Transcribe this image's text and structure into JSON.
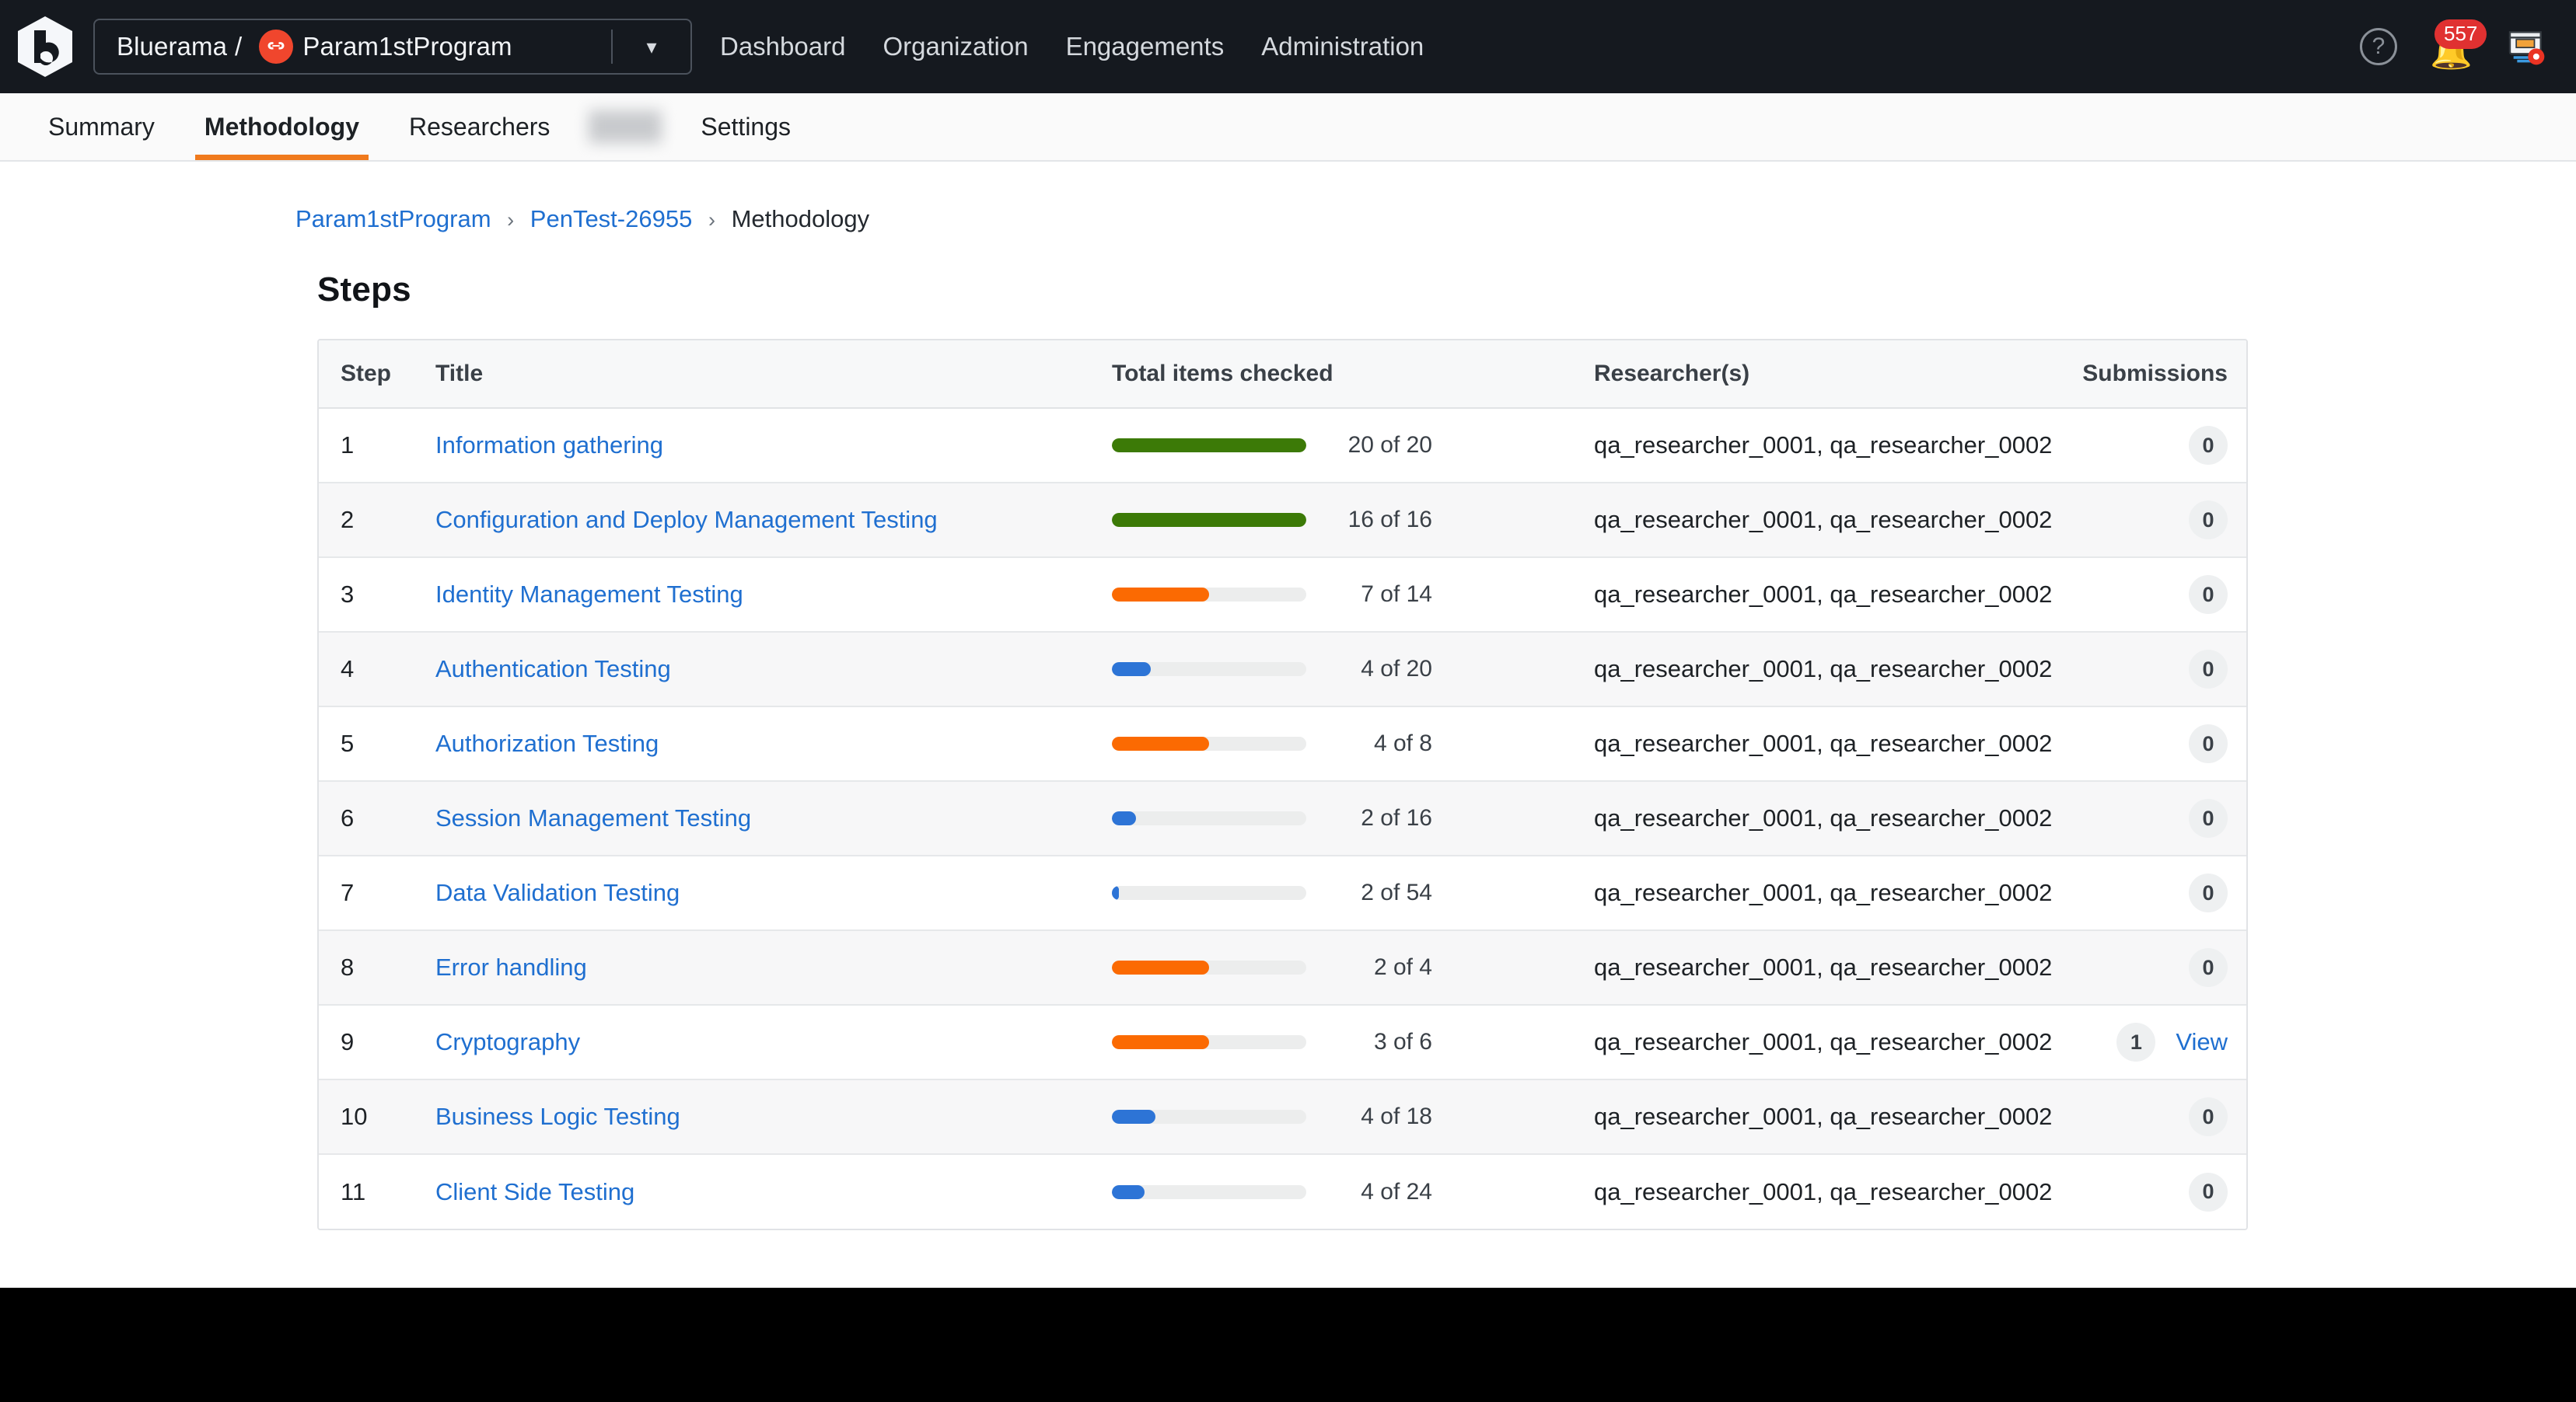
{
  "topbar": {
    "logo_icon": "bugcrowd-hexagon-logo",
    "org_switcher": {
      "org": "Bluerama",
      "separator": "/",
      "program": "Param1stProgram",
      "program_badge_icon": "program-avatar-icon",
      "caret_icon": "chevron-down-icon"
    },
    "nav": [
      {
        "label": "Dashboard",
        "name": "nav-dashboard"
      },
      {
        "label": "Organization",
        "name": "nav-organization"
      },
      {
        "label": "Engagements",
        "name": "nav-engagements"
      },
      {
        "label": "Administration",
        "name": "nav-administration"
      }
    ],
    "help_icon": "question-mark-help-icon",
    "notifications": {
      "count": "557",
      "icon": "bell-notification-icon"
    },
    "apps_icon": "browser-settings-gear-icon"
  },
  "subtabs": [
    {
      "label": "Summary",
      "name": "tab-summary",
      "active": false,
      "redacted": false
    },
    {
      "label": "Methodology",
      "name": "tab-methodology",
      "active": true,
      "redacted": false
    },
    {
      "label": "Researchers",
      "name": "tab-researchers",
      "active": false,
      "redacted": false
    },
    {
      "label": "",
      "name": "tab-redacted",
      "active": false,
      "redacted": true
    },
    {
      "label": "Settings",
      "name": "tab-settings",
      "active": false,
      "redacted": false
    }
  ],
  "breadcrumb": {
    "items": [
      "Param1stProgram",
      "PenTest-26955",
      "Methodology"
    ],
    "separator": "›"
  },
  "page_title": "Steps",
  "table": {
    "columns": {
      "step": "Step",
      "title": "Title",
      "progress": "Total items checked",
      "researchers": "Researcher(s)",
      "submissions": "Submissions"
    },
    "view_label": "View",
    "colors": {
      "complete": "#3c7a07",
      "mid": "#fb6a02",
      "low": "#2d74d6",
      "track": "#eceded"
    },
    "rows": [
      {
        "step": "1",
        "title": "Information gathering",
        "checked": 20,
        "total": 20,
        "progress_label": "20 of 20",
        "color": "#3c7a07",
        "researchers": "qa_researcher_0001, qa_researcher_0002",
        "submissions": "0",
        "has_view": false
      },
      {
        "step": "2",
        "title": "Configuration and Deploy Management Testing",
        "checked": 16,
        "total": 16,
        "progress_label": "16 of 16",
        "color": "#3c7a07",
        "researchers": "qa_researcher_0001, qa_researcher_0002",
        "submissions": "0",
        "has_view": false
      },
      {
        "step": "3",
        "title": "Identity Management Testing",
        "checked": 7,
        "total": 14,
        "progress_label": "7 of 14",
        "color": "#fb6a02",
        "researchers": "qa_researcher_0001, qa_researcher_0002",
        "submissions": "0",
        "has_view": false
      },
      {
        "step": "4",
        "title": "Authentication Testing",
        "checked": 4,
        "total": 20,
        "progress_label": "4 of 20",
        "color": "#2d74d6",
        "researchers": "qa_researcher_0001, qa_researcher_0002",
        "submissions": "0",
        "has_view": false
      },
      {
        "step": "5",
        "title": "Authorization Testing",
        "checked": 4,
        "total": 8,
        "progress_label": "4 of 8",
        "color": "#fb6a02",
        "researchers": "qa_researcher_0001, qa_researcher_0002",
        "submissions": "0",
        "has_view": false
      },
      {
        "step": "6",
        "title": "Session Management Testing",
        "checked": 2,
        "total": 16,
        "progress_label": "2 of 16",
        "color": "#2d74d6",
        "researchers": "qa_researcher_0001, qa_researcher_0002",
        "submissions": "0",
        "has_view": false
      },
      {
        "step": "7",
        "title": "Data Validation Testing",
        "checked": 2,
        "total": 54,
        "progress_label": "2 of 54",
        "color": "#2d74d6",
        "researchers": "qa_researcher_0001, qa_researcher_0002",
        "submissions": "0",
        "has_view": false
      },
      {
        "step": "8",
        "title": "Error handling",
        "checked": 2,
        "total": 4,
        "progress_label": "2 of 4",
        "color": "#fb6a02",
        "researchers": "qa_researcher_0001, qa_researcher_0002",
        "submissions": "0",
        "has_view": false
      },
      {
        "step": "9",
        "title": "Cryptography",
        "checked": 3,
        "total": 6,
        "progress_label": "3 of 6",
        "color": "#fb6a02",
        "researchers": "qa_researcher_0001, qa_researcher_0002",
        "submissions": "1",
        "has_view": true
      },
      {
        "step": "10",
        "title": "Business Logic Testing",
        "checked": 4,
        "total": 18,
        "progress_label": "4 of 18",
        "color": "#2d74d6",
        "researchers": "qa_researcher_0001, qa_researcher_0002",
        "submissions": "0",
        "has_view": false
      },
      {
        "step": "11",
        "title": "Client Side Testing",
        "checked": 4,
        "total": 24,
        "progress_label": "4 of 24",
        "color": "#2d74d6",
        "researchers": "qa_researcher_0001, qa_researcher_0002",
        "submissions": "0",
        "has_view": false
      }
    ]
  }
}
